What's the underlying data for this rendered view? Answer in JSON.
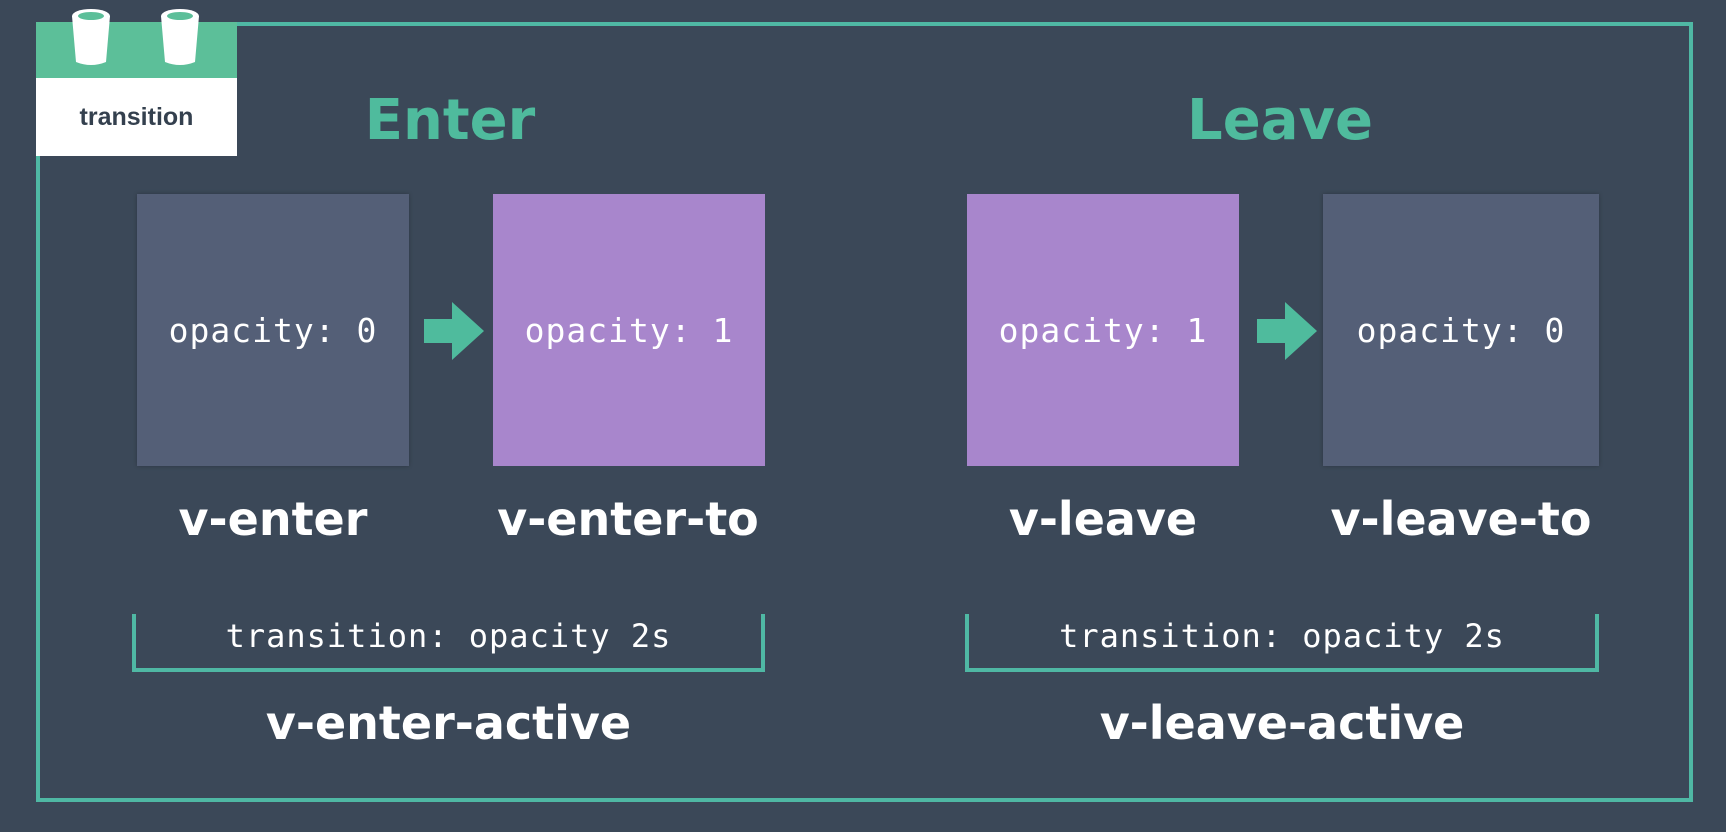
{
  "component": {
    "tab_label": "transition"
  },
  "enter": {
    "title": "Enter",
    "from_box": {
      "text": "opacity: 0",
      "color": "#545f77"
    },
    "to_box": {
      "text": "opacity: 1",
      "color": "#a886cc"
    },
    "from_class": "v-enter",
    "to_class": "v-enter-to",
    "rule": "transition: opacity 2s",
    "active_class": "v-enter-active"
  },
  "leave": {
    "title": "Leave",
    "from_box": {
      "text": "opacity: 1",
      "color": "#a886cc"
    },
    "to_box": {
      "text": "opacity: 0",
      "color": "#545f77"
    },
    "from_class": "v-leave",
    "to_class": "v-leave-to",
    "rule": "transition: opacity 2s",
    "active_class": "v-leave-active"
  },
  "colors": {
    "accent": "#4fb8a4",
    "title": "#4fbb9d",
    "background": "#3b4858"
  },
  "icons": {
    "arrow": "right-arrow-icon",
    "bucket": "bucket-icon"
  }
}
